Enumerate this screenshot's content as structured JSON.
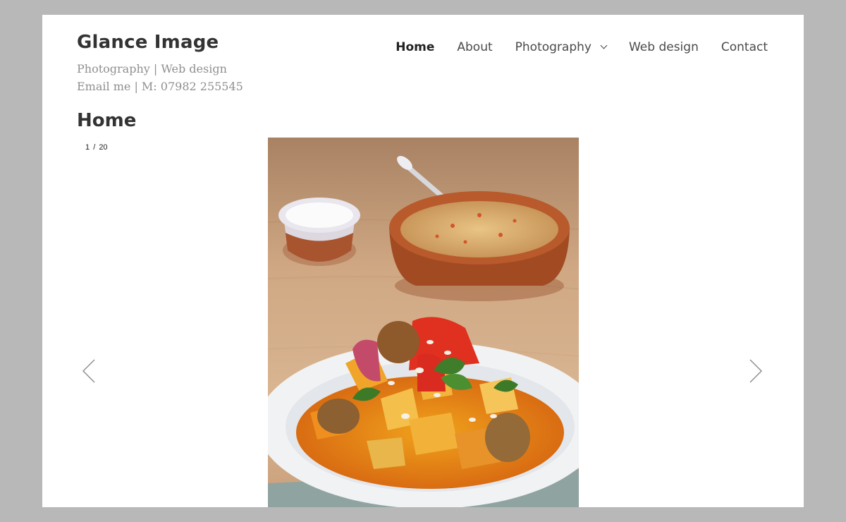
{
  "site": {
    "title": "Glance Image",
    "tagline_line1": "Photography | Web design",
    "tagline_line2": "Email me | M: 07982 255545"
  },
  "nav": {
    "items": [
      {
        "label": "Home",
        "active": true
      },
      {
        "label": "About"
      },
      {
        "label": "Photography",
        "has_dropdown": true
      },
      {
        "label": "Web design"
      },
      {
        "label": "Contact"
      }
    ]
  },
  "page": {
    "title": "Home"
  },
  "slideshow": {
    "current": "1",
    "separator": "/",
    "total": "20",
    "prev_icon": "chevron-left-icon",
    "next_icon": "chevron-right-icon",
    "image_subject": "vegetable tagine photo"
  },
  "colors": {
    "background": "#b8b8b8",
    "page": "#ffffff",
    "title_text": "#333333",
    "tagline_text": "#8f8f8f"
  }
}
